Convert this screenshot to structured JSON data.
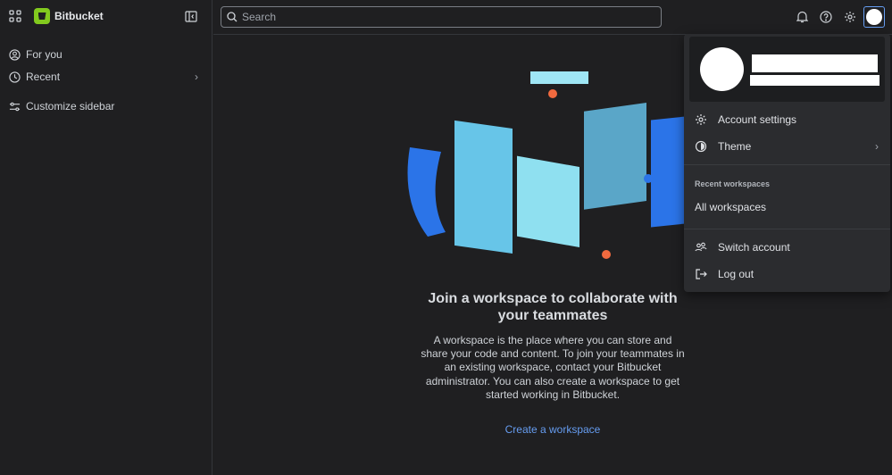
{
  "app": {
    "name": "Bitbucket",
    "brand_color": "#82c91e"
  },
  "sidebar": {
    "items": [
      {
        "label": "For you",
        "icon": "person-circle-icon"
      },
      {
        "label": "Recent",
        "icon": "clock-icon"
      },
      {
        "label": "Customize sidebar",
        "icon": "sliders-icon"
      }
    ]
  },
  "search": {
    "placeholder": "Search"
  },
  "menu": {
    "account_settings": "Account settings",
    "theme": "Theme",
    "recent_heading": "Recent workspaces",
    "all_workspaces": "All workspaces",
    "switch_account": "Switch account",
    "log_out": "Log out"
  },
  "main": {
    "title": "Join a workspace to collaborate with your teammates",
    "description": "A workspace is the place where you can store and share your code and content. To join your teammates in an existing workspace, contact your Bitbucket administrator. You can also create a workspace to get started working in Bitbucket.",
    "create_link": "Create a workspace"
  }
}
